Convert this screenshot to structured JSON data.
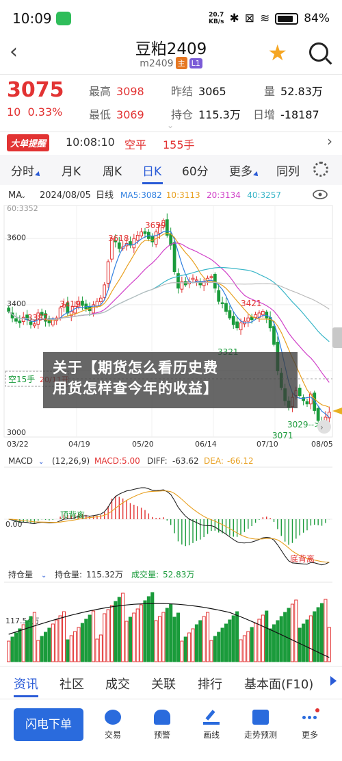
{
  "status_bar": {
    "time": "10:09",
    "net_speed_value": "20.7",
    "net_speed_unit": "KB/s",
    "battery": "84%"
  },
  "nav": {
    "title": "豆粕2409",
    "code": "m2409",
    "tag_main": "主",
    "tag_l1": "L1"
  },
  "quote": {
    "price": "3075",
    "change": "10",
    "change_pct": "0.33%",
    "high_label": "最高",
    "high": "3098",
    "low_label": "最低",
    "low": "3069",
    "prev_settle_label": "昨结",
    "prev_settle": "3065",
    "open_interest_label": "持仓",
    "open_interest": "115.3万",
    "volume_label": "量",
    "volume": "52.83万",
    "daily_change_label": "日增",
    "daily_change": "-18187"
  },
  "ticker": {
    "badge": "大单提醒",
    "time": "10:08:10",
    "type": "空平",
    "qty": "155手"
  },
  "period_tabs": [
    "分时",
    "月K",
    "周K",
    "日K",
    "60分",
    "更多",
    "同列"
  ],
  "active_period": "日K",
  "overlay_text_1": "关于【期货怎么看历史费",
  "overlay_text_2": "用货怎样查今年的收益】",
  "chart_data": [
    {
      "type": "candlestick",
      "title": "",
      "indicator_label": "MA",
      "date": "2024/08/05",
      "period": "日线",
      "legend": [
        {
          "name": "MA5",
          "value": "3082",
          "color": "#2f7fe0"
        },
        {
          "name": "10",
          "value": "3113",
          "color": "#e8a020"
        },
        {
          "name": "20",
          "value": "3134",
          "color": "#d040c8"
        },
        {
          "name": "40",
          "value": "3257",
          "color": "#3ab6c8"
        }
      ],
      "ma60_label": "60:3352",
      "y_ticks": [
        "3600",
        "3400",
        "3000"
      ],
      "x_ticks": [
        "03/22",
        "04/19",
        "05/20",
        "06/14",
        "07/10",
        "08/05"
      ],
      "annotations": [
        "3659",
        "3618",
        "3419",
        "3387",
        "3421",
        "3321",
        "3071",
        "3029"
      ],
      "short_position_label": "空15手",
      "short_position_date": "20/11开",
      "ylim": [
        3000,
        3700
      ],
      "closes": [
        3380,
        3360,
        3350,
        3345,
        3362,
        3355,
        3340,
        3342,
        3375,
        3368,
        3350,
        3345,
        3355,
        3360,
        3390,
        3400,
        3375,
        3380,
        3395,
        3410,
        3398,
        3388,
        3382,
        3400,
        3410,
        3420,
        3460,
        3530,
        3600,
        3590,
        3570,
        3575,
        3585,
        3580,
        3600,
        3610,
        3620,
        3615,
        3600,
        3590,
        3620,
        3640,
        3655,
        3610,
        3580,
        3500,
        3450,
        3470,
        3460,
        3470,
        3480,
        3475,
        3460,
        3470,
        3480,
        3485,
        3450,
        3410,
        3405,
        3380,
        3360,
        3340,
        3330,
        3345,
        3350,
        3360,
        3355,
        3370,
        3375,
        3380,
        3360,
        3330,
        3280,
        3200,
        3150,
        3110,
        3090,
        3120,
        3140,
        3125,
        3110,
        3100,
        3130,
        3080,
        3050,
        3030,
        3060,
        3075
      ]
    },
    {
      "type": "line",
      "name": "MACD",
      "params": "(12,26,9)",
      "macd_label": "MACD:",
      "macd": "5.00",
      "diff_label": "DIFF:",
      "diff": "-63.62",
      "dea_label": "DEA:",
      "dea": "-66.12",
      "zero_tick": "0.00",
      "top_divergence": "顶背离",
      "bottom_divergence": "底背离"
    },
    {
      "type": "bar",
      "name": "持仓量",
      "oi_label": "持仓量:",
      "oi": "115.32万",
      "vol_label": "成交量:",
      "vol": "52.83万",
      "y_tick": "117.54万"
    }
  ],
  "bottom_tabs": [
    "资讯",
    "社区",
    "成交",
    "关联",
    "排行",
    "基本面(F10)"
  ],
  "actions": {
    "flash_order": "闪电下单",
    "items": [
      "交易",
      "预警",
      "画线",
      "走势预测",
      "更多"
    ]
  },
  "colors": {
    "up": "#e23333",
    "down": "#1a9b3b",
    "accent": "#2a5bd7"
  }
}
